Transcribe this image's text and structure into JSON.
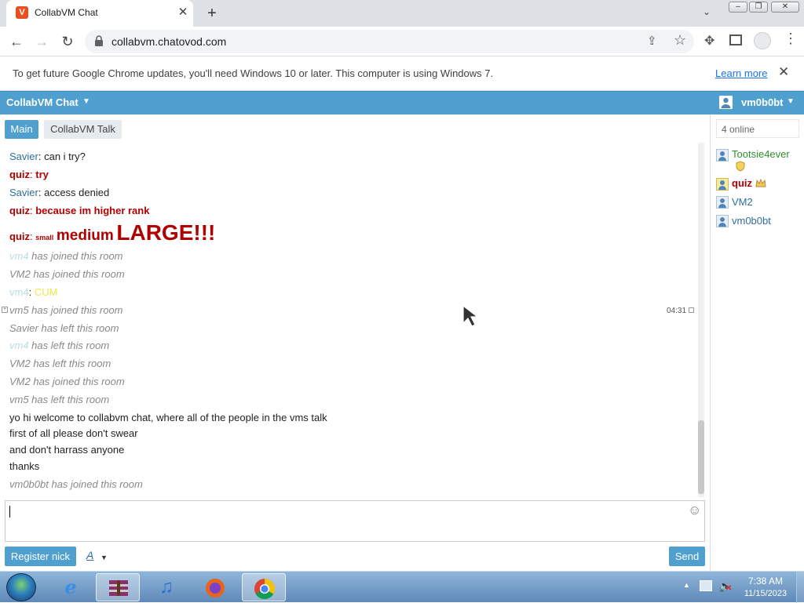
{
  "browser": {
    "tab_title": "CollabVM Chat",
    "favicon_letter": "V",
    "url": "collabvm.chatovod.com",
    "infobar_text": "To get future Google Chrome updates, you'll need Windows 10 or later. This computer is using Windows 7.",
    "infobar_link": "Learn more"
  },
  "app": {
    "title": "CollabVM Chat",
    "current_user": "vm0b0bt",
    "tabs": [
      "Main",
      "CollabVM Talk"
    ],
    "online_count": "4 online",
    "accent_color": "#4f9fcf"
  },
  "messages": [
    {
      "name": "Savier",
      "sep": ":",
      "text": " can i try?"
    },
    {
      "name": "quiz",
      "sep": ":",
      "text": " try"
    },
    {
      "name": "Savier",
      "sep": ":",
      "text": " access denied"
    },
    {
      "name": "quiz",
      "sep": ":",
      "text": " because im higher rank"
    },
    {
      "name": "quiz",
      "sep": ":",
      "small": "small",
      "medium": "medium",
      "large": "LARGE!!!"
    },
    {
      "name": "vm4",
      "text": " has joined this room"
    },
    {
      "text": "VM2 has joined this room"
    },
    {
      "name": "vm4",
      "sep": ":",
      "text": "CUM"
    },
    {
      "text": "vm5 has joined this room"
    },
    {
      "text": "Savier has left this room"
    },
    {
      "name": "vm4",
      "text": " has left this room"
    },
    {
      "text": "VM2 has left this room"
    },
    {
      "text": "VM2 has joined this room"
    },
    {
      "text": "vm5 has left this room"
    },
    {
      "text": "yo hi welcome to collabvm chat, where all of the people in the vms talk"
    },
    {
      "text": "first of all please don't swear"
    },
    {
      "text": "and don't harrass anyone"
    },
    {
      "text": "thanks"
    },
    {
      "text": "vm0b0bt has joined this room"
    }
  ],
  "timestamp": "04:31",
  "users": [
    "Tootsie4ever",
    "quiz",
    "VM2",
    "vm0b0bt"
  ],
  "buttons": {
    "register": "Register nick",
    "font": "A",
    "send": "Send"
  },
  "taskbar": {
    "time": "7:38 AM",
    "date": "11/15/2023",
    "apps": [
      "internet-explorer",
      "winrar",
      "itunes",
      "firefox",
      "chrome"
    ]
  }
}
